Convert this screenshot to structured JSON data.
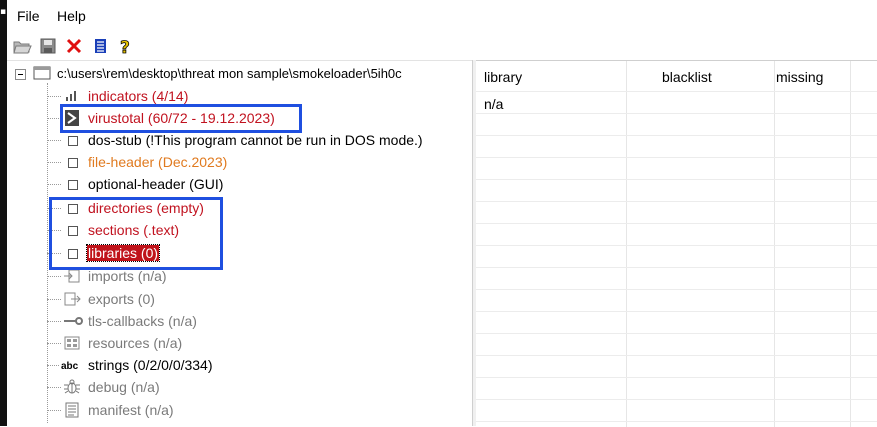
{
  "menu": {
    "file": "File",
    "help": "Help"
  },
  "toolbar": [
    {
      "name": "open-icon"
    },
    {
      "name": "save-icon"
    },
    {
      "name": "close-icon"
    },
    {
      "name": "list-icon"
    },
    {
      "name": "help-icon"
    }
  ],
  "tree": {
    "root": "c:\\users\\rem\\desktop\\threat mon sample\\smokeloader\\5ih0c",
    "items": [
      {
        "label": "indicators (4/14)",
        "color": "red"
      },
      {
        "label": "virustotal (60/72 - 19.12.2023)",
        "color": "red"
      },
      {
        "label": "dos-stub (!This program cannot be run in DOS mode.)",
        "color": "black"
      },
      {
        "label": "file-header (Dec.2023)",
        "color": "orange"
      },
      {
        "label": "optional-header (GUI)",
        "color": "black"
      },
      {
        "label": "directories (empty)",
        "color": "red"
      },
      {
        "label": "sections (.text)",
        "color": "red"
      },
      {
        "label": "libraries (0)",
        "color": "highlight"
      },
      {
        "label": "imports (n/a)",
        "color": "gray"
      },
      {
        "label": "exports (0)",
        "color": "gray"
      },
      {
        "label": "tls-callbacks (n/a)",
        "color": "gray"
      },
      {
        "label": "resources (n/a)",
        "color": "gray"
      },
      {
        "label": "strings (0/2/0/0/334)",
        "color": "black"
      },
      {
        "label": "debug (n/a)",
        "color": "gray"
      },
      {
        "label": "manifest (n/a)",
        "color": "gray"
      }
    ]
  },
  "grid": {
    "columns": [
      "library",
      "blacklist",
      "missing"
    ],
    "rows": [
      [
        "n/a",
        "",
        ""
      ]
    ]
  },
  "colors": {
    "red": "#c1121f",
    "orange": "#e07a1f",
    "gray": "#7a7a7a",
    "annotation_box": "#1f4fe0"
  }
}
